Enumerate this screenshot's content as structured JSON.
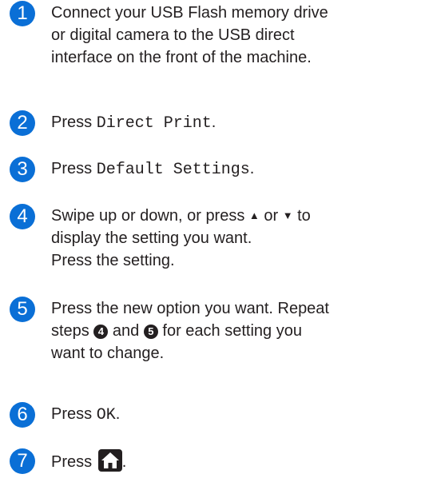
{
  "accent_color": "#0a6fd6",
  "steps": [
    {
      "number": "1",
      "lines": "Connect your USB Flash memory drive\nor digital camera to the USB direct\ninterface on the front of the machine."
    },
    {
      "number": "2",
      "prefix": "Press ",
      "code": "Direct Print",
      "suffix": "."
    },
    {
      "number": "3",
      "prefix": "Press ",
      "code": "Default Settings",
      "suffix": "."
    },
    {
      "number": "4",
      "line1a": "Swipe up or down, or press ",
      "up": "▲",
      "or": " or ",
      "down": "▼",
      "line1b": " to",
      "rest": "display the setting you want.\nPress the setting."
    },
    {
      "number": "5",
      "line1": "Press the new option you want. Repeat",
      "steps_word": "steps ",
      "ref1": "4",
      "and": " and ",
      "ref2": "5",
      "tail": " for each setting you",
      "line3": "want to change."
    },
    {
      "number": "6",
      "prefix": "Press ",
      "code": "OK",
      "suffix": "."
    },
    {
      "number": "7",
      "prefix": "Press ",
      "icon": "home-icon",
      "suffix": "."
    }
  ]
}
